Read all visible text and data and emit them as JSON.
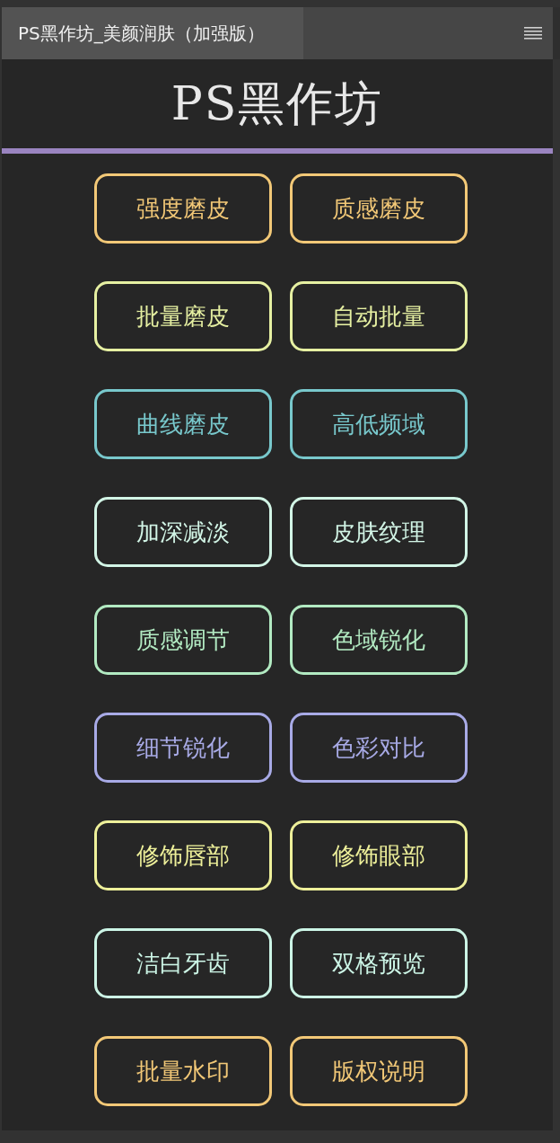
{
  "tabs": [
    {
      "label": "PS黑作坊_美颜润肤（加强版）",
      "selected": true
    }
  ],
  "logo": {
    "text": "PS黑作坊"
  },
  "buttons": [
    {
      "label": "强度磨皮",
      "color": "#f2c877"
    },
    {
      "label": "质感磨皮",
      "color": "#f2c877"
    },
    {
      "label": "批量磨皮",
      "color": "#e6f0a2"
    },
    {
      "label": "自动批量",
      "color": "#e6f0a2"
    },
    {
      "label": "曲线磨皮",
      "color": "#78c8cc"
    },
    {
      "label": "高低频域",
      "color": "#78c8cc"
    },
    {
      "label": "加深减淡",
      "color": "#d2f5e6"
    },
    {
      "label": "皮肤纹理",
      "color": "#d2f5e6"
    },
    {
      "label": "质感调节",
      "color": "#b2eac2"
    },
    {
      "label": "色域锐化",
      "color": "#b2eac2"
    },
    {
      "label": "细节锐化",
      "color": "#a8aae6"
    },
    {
      "label": "色彩对比",
      "color": "#a8aae6"
    },
    {
      "label": "修饰唇部",
      "color": "#eef09a"
    },
    {
      "label": "修饰眼部",
      "color": "#eef09a"
    },
    {
      "label": "洁白牙齿",
      "color": "#ccf5e6"
    },
    {
      "label": "双格预览",
      "color": "#ccf5e6"
    },
    {
      "label": "批量水印",
      "color": "#f2c877"
    },
    {
      "label": "版权说明",
      "color": "#f2c877"
    }
  ]
}
